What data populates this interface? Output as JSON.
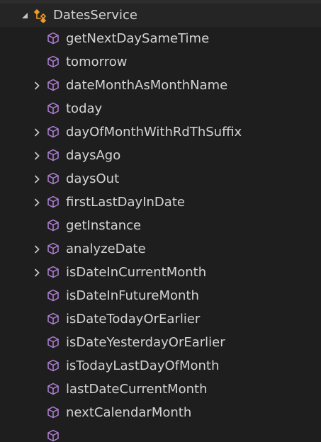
{
  "tree": {
    "root": {
      "label": "DatesService",
      "expanded": true,
      "icon": "class-icon"
    },
    "members": [
      {
        "label": "getNextDaySameTime",
        "expandable": false,
        "icon": "method-cube-icon"
      },
      {
        "label": "tomorrow",
        "expandable": false,
        "icon": "method-cube-icon"
      },
      {
        "label": "dateMonthAsMonthName",
        "expandable": true,
        "icon": "method-cube-icon"
      },
      {
        "label": "today",
        "expandable": false,
        "icon": "method-cube-icon"
      },
      {
        "label": "dayOfMonthWithRdThSuffix",
        "expandable": true,
        "icon": "method-cube-icon"
      },
      {
        "label": "daysAgo",
        "expandable": true,
        "icon": "method-cube-icon"
      },
      {
        "label": "daysOut",
        "expandable": true,
        "icon": "method-cube-icon"
      },
      {
        "label": "firstLastDayInDate",
        "expandable": true,
        "icon": "method-cube-icon"
      },
      {
        "label": "getInstance",
        "expandable": false,
        "icon": "method-cube-icon"
      },
      {
        "label": "analyzeDate",
        "expandable": true,
        "icon": "method-cube-icon"
      },
      {
        "label": "isDateInCurrentMonth",
        "expandable": true,
        "icon": "method-cube-icon"
      },
      {
        "label": "isDateInFutureMonth",
        "expandable": false,
        "icon": "method-cube-icon"
      },
      {
        "label": "isDateTodayOrEarlier",
        "expandable": false,
        "icon": "method-cube-icon"
      },
      {
        "label": "isDateYesterdayOrEarlier",
        "expandable": false,
        "icon": "method-cube-icon"
      },
      {
        "label": "isTodayLastDayOfMonth",
        "expandable": false,
        "icon": "method-cube-icon"
      },
      {
        "label": "lastDateCurrentMonth",
        "expandable": false,
        "icon": "method-cube-icon"
      },
      {
        "label": "nextCalendarMonth",
        "expandable": false,
        "icon": "method-cube-icon"
      }
    ]
  },
  "colors": {
    "background": "#1e1e1e",
    "text": "#d4d4d4",
    "method_icon": "#b180d7",
    "class_icon": "#ee9d28",
    "twisty": "#c5c5c5"
  }
}
